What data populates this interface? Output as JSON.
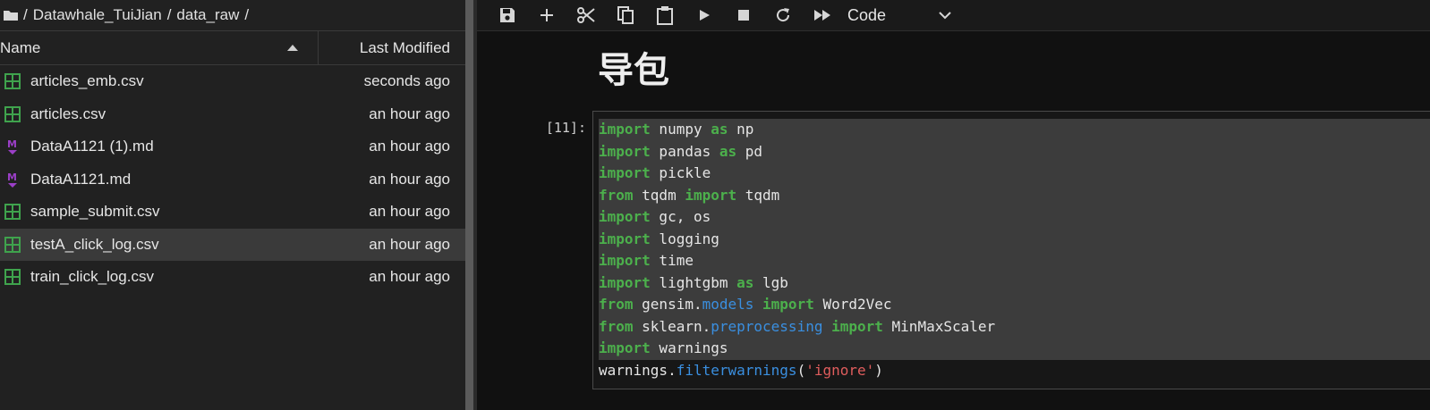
{
  "breadcrumbs": {
    "icon": "folder-icon",
    "parts": [
      "/",
      "Datawhale_TuiJian",
      "/",
      "data_raw",
      "/"
    ]
  },
  "file_list": {
    "header": {
      "name": "Name",
      "last_modified": "Last Modified"
    },
    "files": [
      {
        "name": "articles_emb.csv",
        "modified": "seconds ago",
        "icon": "csv-file-icon",
        "selected": false
      },
      {
        "name": "articles.csv",
        "modified": "an hour ago",
        "icon": "csv-file-icon",
        "selected": false
      },
      {
        "name": "DataA1121 (1).md",
        "modified": "an hour ago",
        "icon": "markdown-file-icon",
        "selected": false
      },
      {
        "name": "DataA1121.md",
        "modified": "an hour ago",
        "icon": "markdown-file-icon",
        "selected": false
      },
      {
        "name": "sample_submit.csv",
        "modified": "an hour ago",
        "icon": "csv-file-icon",
        "selected": false
      },
      {
        "name": "testA_click_log.csv",
        "modified": "an hour ago",
        "icon": "csv-file-icon",
        "selected": true
      },
      {
        "name": "train_click_log.csv",
        "modified": "an hour ago",
        "icon": "csv-file-icon",
        "selected": false
      }
    ]
  },
  "toolbar": {
    "buttons": [
      "save-icon",
      "add-icon",
      "cut-icon",
      "copy-icon",
      "paste-icon",
      "run-icon",
      "stop-icon",
      "restart-icon",
      "fast-forward-icon"
    ],
    "cell_type": "Code"
  },
  "notebook": {
    "heading": "导包",
    "prompt": "[11]:",
    "code_lines": [
      [
        {
          "t": "import",
          "c": "kw"
        },
        {
          "t": " numpy "
        },
        {
          "t": "as",
          "c": "kw"
        },
        {
          "t": " np"
        }
      ],
      [
        {
          "t": "import",
          "c": "kw"
        },
        {
          "t": " pandas "
        },
        {
          "t": "as",
          "c": "kw"
        },
        {
          "t": " pd"
        }
      ],
      [
        {
          "t": "import",
          "c": "kw"
        },
        {
          "t": " pickle"
        }
      ],
      [
        {
          "t": "from",
          "c": "kw"
        },
        {
          "t": " tqdm "
        },
        {
          "t": "import",
          "c": "kw"
        },
        {
          "t": " tqdm"
        }
      ],
      [
        {
          "t": "import",
          "c": "kw"
        },
        {
          "t": " gc, os"
        }
      ],
      [
        {
          "t": "import",
          "c": "kw"
        },
        {
          "t": " logging"
        }
      ],
      [
        {
          "t": "import",
          "c": "kw"
        },
        {
          "t": " time"
        }
      ],
      [
        {
          "t": "import",
          "c": "kw"
        },
        {
          "t": " lightgbm "
        },
        {
          "t": "as",
          "c": "kw"
        },
        {
          "t": " lgb"
        }
      ],
      [
        {
          "t": "from",
          "c": "kw"
        },
        {
          "t": " gensim."
        },
        {
          "t": "models",
          "c": "attr"
        },
        {
          "t": " "
        },
        {
          "t": "import",
          "c": "kw"
        },
        {
          "t": " Word2Vec"
        }
      ],
      [
        {
          "t": "from",
          "c": "kw"
        },
        {
          "t": " sklearn."
        },
        {
          "t": "preprocessing",
          "c": "attr"
        },
        {
          "t": " "
        },
        {
          "t": "import",
          "c": "kw"
        },
        {
          "t": " MinMaxScaler"
        }
      ],
      [
        {
          "t": "import",
          "c": "kw"
        },
        {
          "t": " warnings"
        }
      ],
      [
        {
          "t": "warnings."
        },
        {
          "t": "filterwarnings",
          "c": "attr"
        },
        {
          "t": "("
        },
        {
          "t": "'ignore'",
          "c": "str"
        },
        {
          "t": ")"
        }
      ]
    ]
  }
}
